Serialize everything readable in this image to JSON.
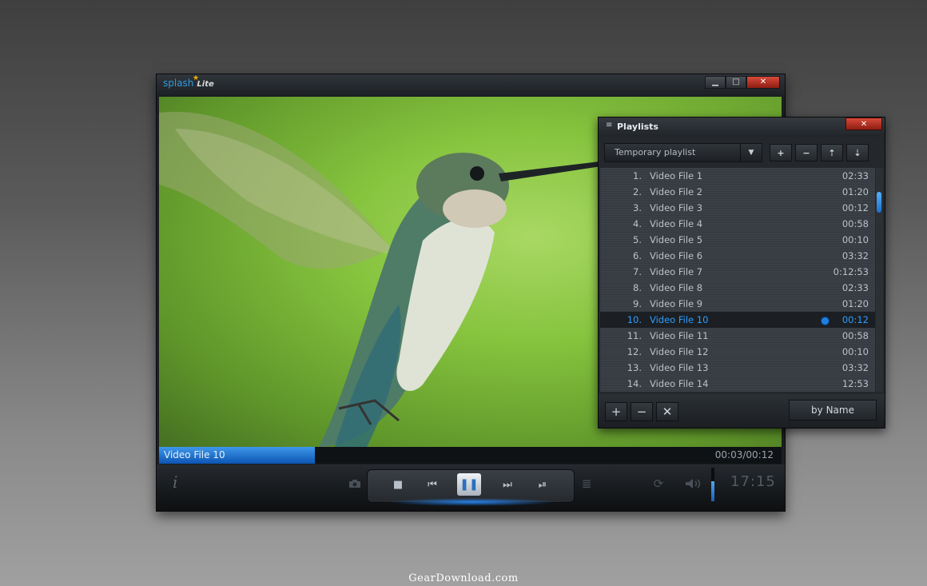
{
  "app": {
    "logo_text": "splash",
    "logo_edition": "Lite"
  },
  "window_controls": {
    "minimize": "▁",
    "maximize": "□",
    "close": "✕"
  },
  "now_playing": {
    "title": "Video File 10",
    "time": "00:03/00:12",
    "progress": 0.25
  },
  "controls": {
    "info_icon": "i",
    "snapshot_icon": "camera-icon",
    "stop": "■",
    "prev": "⏮",
    "pause": "❚❚",
    "next": "⏭",
    "frame_step": "⏯",
    "playlist_icon": "≣",
    "repeat_icon": "⟳",
    "volume_icon": "🔈",
    "volume_level": 0.6,
    "clock": "17:15"
  },
  "playlist": {
    "title": "Playlists",
    "title_icon": "≡",
    "close": "✕",
    "selected_playlist": "Temporary playlist",
    "tools": [
      "+",
      "−",
      "⇡",
      "⇣"
    ],
    "items": [
      {
        "num": "1.",
        "name": "Video File 1",
        "duration": "02:33"
      },
      {
        "num": "2.",
        "name": "Video File 2",
        "duration": "01:20"
      },
      {
        "num": "3.",
        "name": "Video File 3",
        "duration": "00:12"
      },
      {
        "num": "4.",
        "name": "Video File 4",
        "duration": "00:58"
      },
      {
        "num": "5.",
        "name": "Video File 5",
        "duration": "00:10"
      },
      {
        "num": "6.",
        "name": "Video File 6",
        "duration": "03:32"
      },
      {
        "num": "7.",
        "name": "Video File 7",
        "duration": "0:12:53"
      },
      {
        "num": "8.",
        "name": "Video File 8",
        "duration": "02:33"
      },
      {
        "num": "9.",
        "name": "Video File  9",
        "duration": "01:20"
      },
      {
        "num": "10.",
        "name": "Video File 10",
        "duration": "00:12",
        "active": true
      },
      {
        "num": "11.",
        "name": "Video File 11",
        "duration": "00:58"
      },
      {
        "num": "12.",
        "name": "Video File 12",
        "duration": "00:10"
      },
      {
        "num": "13.",
        "name": "Video File 13",
        "duration": "03:32"
      },
      {
        "num": "14.",
        "name": "Video File 14",
        "duration": "12:53"
      }
    ],
    "bottom": {
      "add": "+",
      "remove": "−",
      "clear": "✕",
      "sort": "by Name"
    }
  },
  "watermark": "GearDownload.com",
  "colors": {
    "accent": "#2f9dff",
    "close_red": "#c8392b",
    "video_green": "#86c43e"
  }
}
